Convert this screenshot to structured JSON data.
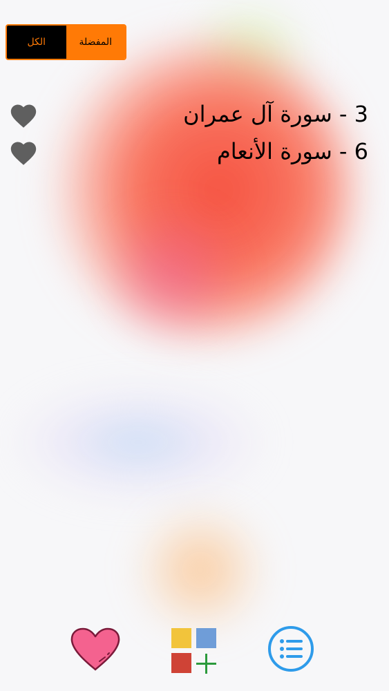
{
  "filter": {
    "all_label": "الكل",
    "favorites_label": "المفضلة",
    "selected": "all"
  },
  "favorites": [
    {
      "label": "3 - سورة  آل عمران",
      "icon": "heart-icon"
    },
    {
      "label": "6 - سورة الأنعام",
      "icon": "heart-icon"
    }
  ],
  "toolbar": {
    "favorites_icon": "heart-icon",
    "apps_icon": "apps-grid-plus-icon",
    "list_icon": "list-icon"
  },
  "colors": {
    "accent": "#ff7a06",
    "segment_selected_bg": "#000000",
    "heart_gray": "#5f5f5f",
    "heart_pink": "#f4628f",
    "list_blue": "#2e9bea"
  }
}
